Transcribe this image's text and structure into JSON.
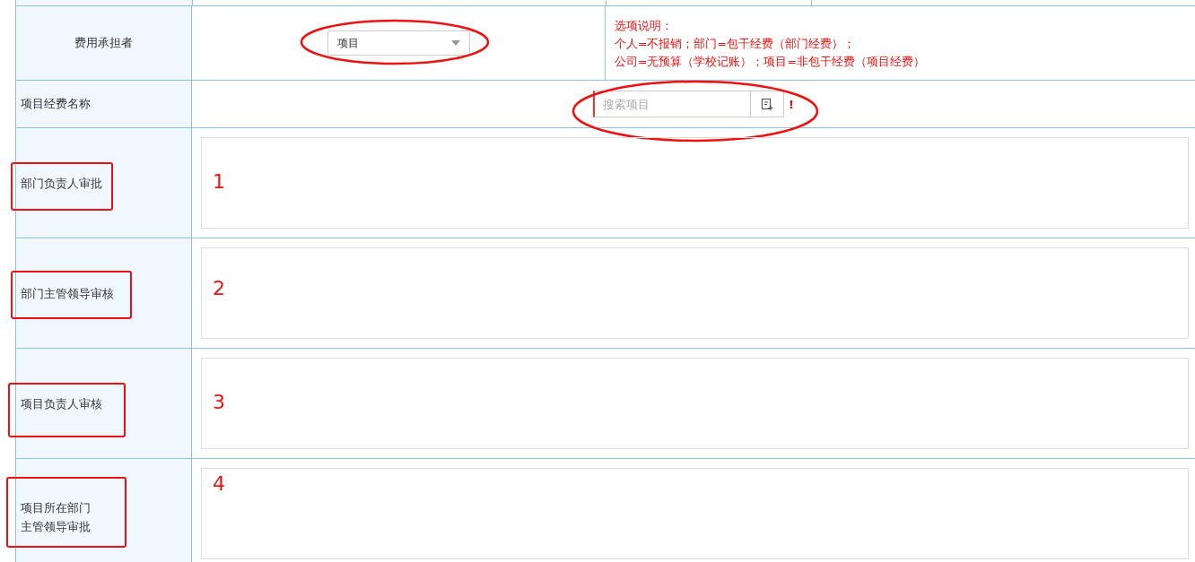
{
  "form": {
    "cost_bearer": {
      "label": "费用承担者",
      "value": "项目",
      "circled": true,
      "note": [
        "选项说明：",
        "个人=不报销；部门=包干经费（部门经费）；",
        "公司=无预算（学校记账）；项目=非包干经费（项目经费）"
      ]
    },
    "project_fund": {
      "label": "项目经费名称",
      "placeholder": "搜索项目",
      "required_mark": "!",
      "circled": true
    },
    "approvals": [
      {
        "label_lines": [
          "部门负责人审批"
        ],
        "boxed": true,
        "number": "1"
      },
      {
        "label_lines": [
          "部门主管领导审核"
        ],
        "boxed": true,
        "number": "2"
      },
      {
        "label_lines": [
          "项目负责人审核"
        ],
        "boxed": true,
        "number": "3"
      },
      {
        "label_lines": [
          "项目所在部门",
          "主管领导审批"
        ],
        "boxed": true,
        "number": "4"
      }
    ]
  }
}
